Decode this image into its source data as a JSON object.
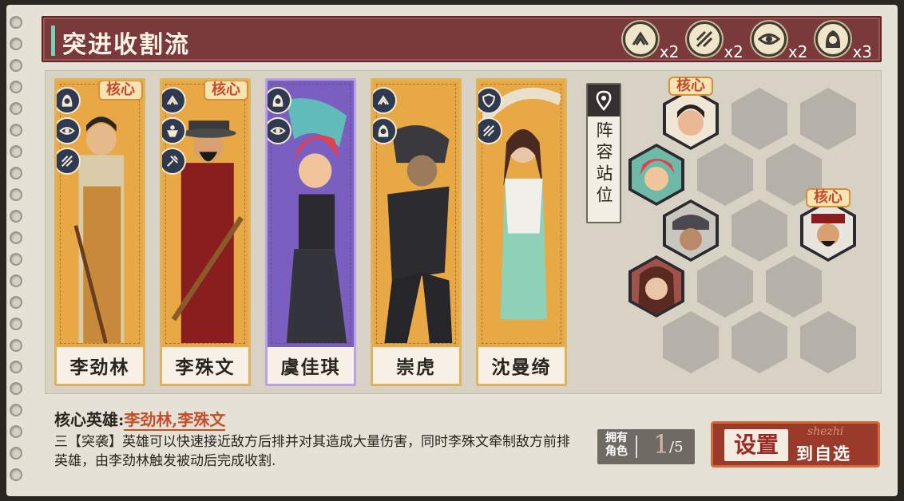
{
  "header": {
    "title": "突进收割流"
  },
  "synergies": [
    {
      "icon": "charge-icon",
      "count": "x2"
    },
    {
      "icon": "slash-icon",
      "count": "x2"
    },
    {
      "icon": "eye-icon",
      "count": "x2"
    },
    {
      "icon": "hooded-figure-icon",
      "count": "x3"
    }
  ],
  "heroes": [
    {
      "name": "李劲林",
      "core": "核心",
      "traits": [
        "hooded-figure-icon",
        "eye-icon",
        "slash-icon"
      ]
    },
    {
      "name": "李殊文",
      "core": "核心",
      "traits": [
        "charge-icon",
        "muscle-icon",
        "shield-break-icon"
      ]
    },
    {
      "name": "虞佳琪",
      "core": "",
      "traits": [
        "hooded-figure-icon",
        "eye-icon"
      ]
    },
    {
      "name": "崇虎",
      "core": "",
      "traits": [
        "charge-icon",
        "hooded-figure-icon"
      ]
    },
    {
      "name": "沈曼绮",
      "core": "",
      "traits": [
        "shield-icon",
        "slash-icon"
      ]
    }
  ],
  "formation": {
    "button_label": "阵容站位",
    "core_tag": "核心"
  },
  "core_heroes": {
    "label": "核心英雄:",
    "value": "李劲林,李殊文"
  },
  "description": "三【突袭】英雄可以快速接近敌方后排并对其造成大量伤害，同时李殊文牵制敌方前排英雄，由李劲林触发被动后完成收割.",
  "owned": {
    "label": "拥有角色",
    "current": "1",
    "total": "/5"
  },
  "set_button": {
    "big": "设置",
    "small": "到自选",
    "ghost": "shezhi"
  },
  "colors": {
    "header": "#7a3a3c",
    "accent": "#7ad0b6",
    "core_text": "#c2492a",
    "button": "#9a3a2a"
  }
}
